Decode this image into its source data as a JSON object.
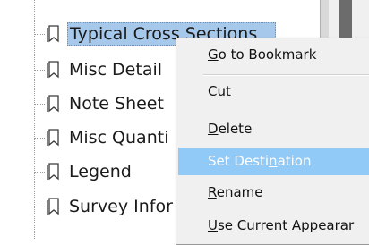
{
  "bookmarks": {
    "items": [
      {
        "label": "Typical Cross Sections",
        "selected": true
      },
      {
        "label": "Misc Detail"
      },
      {
        "label": "Note Sheet"
      },
      {
        "label": "Misc Quanti"
      },
      {
        "label": "Legend"
      },
      {
        "label": "Survey Infor"
      }
    ]
  },
  "context_menu": {
    "items": [
      {
        "label": "Go to Bookmark",
        "accel": "G"
      },
      {
        "label": "Cut",
        "accel": "t"
      },
      {
        "label": "Delete",
        "accel": "D"
      },
      {
        "label": "Set Destination",
        "accel": "n",
        "highlighted": true
      },
      {
        "label": "Rename",
        "accel": "R"
      },
      {
        "label": "Use Current Appearar",
        "accel": "U"
      }
    ]
  },
  "colors": {
    "selection": "#a6c8ea",
    "menu_highlight": "#91c9f7",
    "menu_background": "#f0f0f0"
  }
}
